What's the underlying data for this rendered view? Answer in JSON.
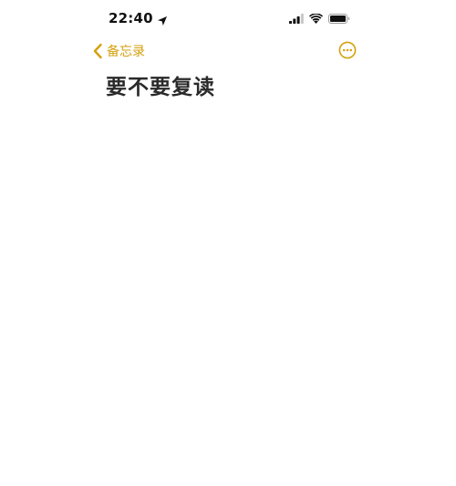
{
  "status_bar": {
    "time": "22:40",
    "icons": [
      "location-arrow-icon",
      "signal-bars-icon",
      "wifi-icon",
      "battery-icon"
    ]
  },
  "nav": {
    "back_label": "备忘录",
    "back_icon": "chevron-left-icon",
    "more_icon": "ellipsis-circle-icon",
    "accent_color": "#d4a00c"
  },
  "note": {
    "title": "要不要复读",
    "body": ""
  }
}
